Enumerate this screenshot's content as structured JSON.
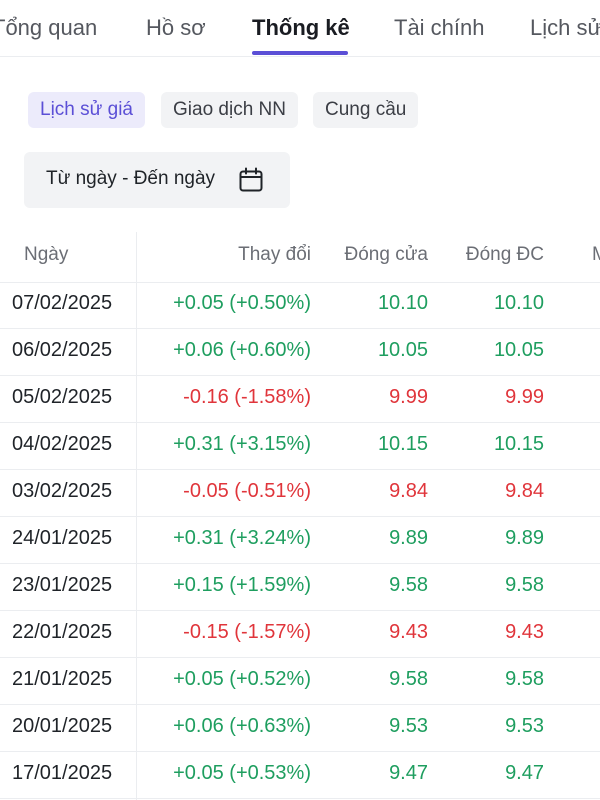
{
  "tabs": [
    {
      "label": "Tổng quan"
    },
    {
      "label": "Hồ sơ"
    },
    {
      "label": "Thống kê"
    },
    {
      "label": "Tài chính"
    },
    {
      "label": "Lịch sử"
    }
  ],
  "active_tab": "Thống kê",
  "subtabs": [
    {
      "label": "Lịch sử giá"
    },
    {
      "label": "Giao dịch NN"
    },
    {
      "label": "Cung cầu"
    }
  ],
  "active_subtab": "Lịch sử giá",
  "date_range": {
    "label": "Từ ngày - Đến ngày",
    "icon": "calendar-icon"
  },
  "table": {
    "columns": [
      "Ngày",
      "Thay đổi",
      "Đóng cửa",
      "Đóng ĐC",
      "M"
    ],
    "rows": [
      {
        "date": "07/02/2025",
        "change": "+0.05 (+0.50%)",
        "close": "10.10",
        "adj_close": "10.10",
        "trend": "up"
      },
      {
        "date": "06/02/2025",
        "change": "+0.06 (+0.60%)",
        "close": "10.05",
        "adj_close": "10.05",
        "trend": "up"
      },
      {
        "date": "05/02/2025",
        "change": "-0.16 (-1.58%)",
        "close": "9.99",
        "adj_close": "9.99",
        "trend": "down"
      },
      {
        "date": "04/02/2025",
        "change": "+0.31 (+3.15%)",
        "close": "10.15",
        "adj_close": "10.15",
        "trend": "up"
      },
      {
        "date": "03/02/2025",
        "change": "-0.05 (-0.51%)",
        "close": "9.84",
        "adj_close": "9.84",
        "trend": "down"
      },
      {
        "date": "24/01/2025",
        "change": "+0.31 (+3.24%)",
        "close": "9.89",
        "adj_close": "9.89",
        "trend": "up"
      },
      {
        "date": "23/01/2025",
        "change": "+0.15 (+1.59%)",
        "close": "9.58",
        "adj_close": "9.58",
        "trend": "up"
      },
      {
        "date": "22/01/2025",
        "change": "-0.15 (-1.57%)",
        "close": "9.43",
        "adj_close": "9.43",
        "trend": "down"
      },
      {
        "date": "21/01/2025",
        "change": "+0.05 (+0.52%)",
        "close": "9.58",
        "adj_close": "9.58",
        "trend": "up"
      },
      {
        "date": "20/01/2025",
        "change": "+0.06 (+0.63%)",
        "close": "9.53",
        "adj_close": "9.53",
        "trend": "up"
      },
      {
        "date": "17/01/2025",
        "change": "+0.05 (+0.53%)",
        "close": "9.47",
        "adj_close": "9.47",
        "trend": "up"
      }
    ]
  },
  "colors": {
    "accent": "#5b4fd6",
    "up": "#1e9e5f",
    "down": "#e0353b"
  }
}
